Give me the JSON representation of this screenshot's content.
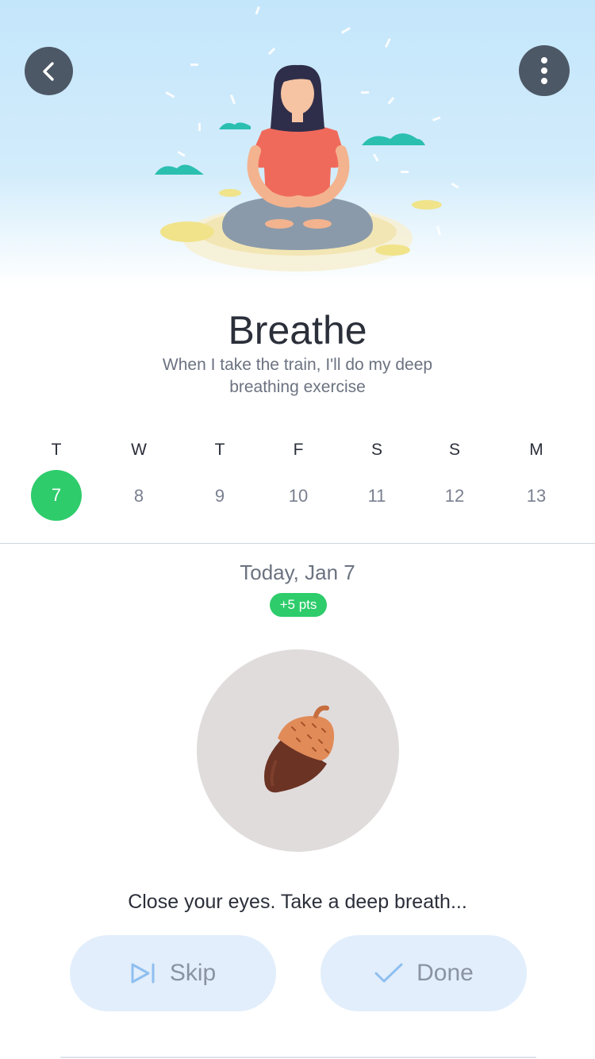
{
  "header": {
    "back_icon": "chevron-left-icon",
    "more_icon": "vertical-dots-icon",
    "illustration": "woman-meditating-illustration"
  },
  "habit": {
    "title": "Breathe",
    "subtitle": "When I take the train, I'll do my deep breathing exercise"
  },
  "week": {
    "days": [
      {
        "letter": "T",
        "num": "7",
        "active": true
      },
      {
        "letter": "W",
        "num": "8",
        "active": false
      },
      {
        "letter": "T",
        "num": "9",
        "active": false
      },
      {
        "letter": "F",
        "num": "10",
        "active": false
      },
      {
        "letter": "S",
        "num": "11",
        "active": false
      },
      {
        "letter": "S",
        "num": "12",
        "active": false
      },
      {
        "letter": "M",
        "num": "13",
        "active": false
      }
    ]
  },
  "detail": {
    "date": "Today, Jan 7",
    "points": "+5 pts",
    "image": "acorn-icon",
    "instruction": "Close your eyes. Take a deep breath..."
  },
  "actions": {
    "skip_label": "Skip",
    "skip_icon": "skip-icon",
    "done_label": "Done",
    "done_icon": "check-icon"
  },
  "colors": {
    "accent_green": "#2ecc6b",
    "button_bg": "#e2eefb",
    "icon_button_bg": "#4d5866"
  }
}
